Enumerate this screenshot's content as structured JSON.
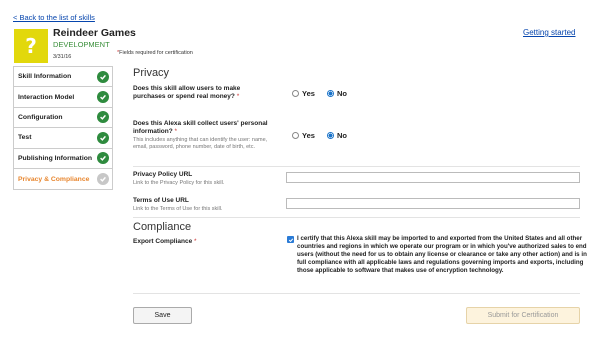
{
  "header": {
    "back_link": "< Back to the list of skills",
    "getting_started": "Getting started",
    "app_name": "Reindeer Games",
    "app_status": "DEVELOPMENT",
    "app_date": "3/31/16",
    "app_icon_glyph": "?",
    "required_note_star": "*",
    "required_note": "Fields required for certification"
  },
  "sidebar": {
    "items": [
      {
        "label": "Skill Information",
        "status": "complete"
      },
      {
        "label": "Interaction Model",
        "status": "complete"
      },
      {
        "label": "Configuration",
        "status": "complete"
      },
      {
        "label": "Test",
        "status": "complete"
      },
      {
        "label": "Publishing Information",
        "status": "complete"
      },
      {
        "label": "Privacy & Compliance",
        "status": "pending",
        "active": true
      }
    ]
  },
  "privacy": {
    "title": "Privacy",
    "q1": {
      "label": "Does this skill allow users to make purchases or spend real money?",
      "star": "*",
      "yes": "Yes",
      "no": "No",
      "selected": "No"
    },
    "q2": {
      "label": "Does this Alexa skill collect users' personal information?",
      "star": "*",
      "help": "This includes anything that can identify the user: name, email, password, phone number, date of birth, etc.",
      "yes": "Yes",
      "no": "No",
      "selected": "No"
    },
    "privacy_url": {
      "label": "Privacy Policy URL",
      "help": "Link to the Privacy Policy for this skill.",
      "value": ""
    },
    "terms_url": {
      "label": "Terms of Use URL",
      "help": "Link to the Terms of Use for this skill.",
      "value": ""
    }
  },
  "compliance": {
    "title": "Compliance",
    "export_label": "Export Compliance",
    "star": "*",
    "checked": true,
    "export_text": "I certify that this Alexa skill may be imported to and exported from the United States and all other countries and regions in which we operate our program or in which you've authorized sales to end users (without the need for us to obtain any license or clearance or take any other action) and is in full compliance with all applicable laws and regulations governing imports and exports, including those applicable to software that makes use of encryption technology."
  },
  "buttons": {
    "save": "Save",
    "submit": "Submit for Certification"
  },
  "colors": {
    "check_green": "#2e8b3e",
    "active_orange": "#e8862e",
    "link_blue": "#0645ad",
    "app_icon_yellow": "#e2d80c"
  }
}
